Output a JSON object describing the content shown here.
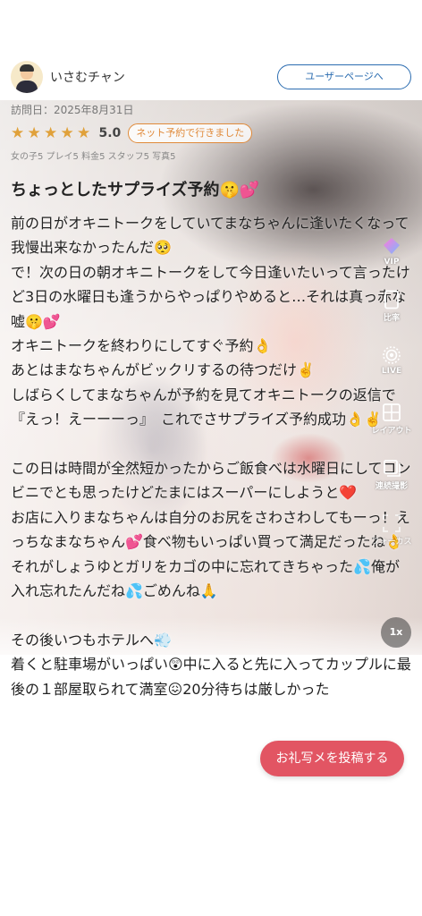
{
  "header": {
    "username": "いさむチャン",
    "user_page_button": "ユーザーページへ"
  },
  "visit": {
    "date_text": "訪問日：2025年8月31日"
  },
  "rating": {
    "stars": 5,
    "score": "5.0",
    "badge": "ネット予約で行きました",
    "sub_ratings": "女の子5 プレイ5 料金5 スタッフ5 写真5"
  },
  "review": {
    "title": "ちょっとしたサプライズ予約🤫💕",
    "body": "前の日がオキニトークをしていてまなちゃんに逢いたくなって我慢出来なかったんだ🥺\nで！次の日の朝オキニトークをして今日逢いたいって言ったけど3日の水曜日も逢うからやっぱりやめると…それは真っ赤な嘘🤫💕\nオキニトークを終わりにしてすぐ予約👌\nあとはまなちゃんがビックリするの待つだけ✌️\nしばらくしてまなちゃんが予約を見てオキニトークの返信で『えっ！えーーーっ』　これでさサプライズ予約成功👌✌️\n\nこの日は時間が全然短かったからご飯食べは水曜日にしてコンビニでとも思ったけどたまにはスーパーにしようと❤️\nお店に入りまなちゃんは自分のお尻をさわさわしてもーっ！えっちなまなちゃん💕食べ物もいっぱい買って満足だったね👌\nそれがしょうゆとガリをカゴの中に忘れてきちゃった💦俺が入れ忘れたんだね💦ごめんね🙏\n\nその後いつもホテルへ💨\n着くと駐車場がいっぱい😲中に入ると先に入ってカップルに最後の１部屋取られて満室😖20分待ちは厳しかった"
  },
  "side_tools": {
    "vip": "VIP",
    "ratio_icon": "3:4",
    "ratio": "比率",
    "live": "LIVE",
    "layout": "レイアウト",
    "burst": "連続撮影",
    "focus": "フォーカス"
  },
  "speed": "1x",
  "post_button": "お礼写メを投稿する",
  "colors": {
    "accent_blue": "#2b6cb0",
    "star": "#e0a13a",
    "badge_orange": "#e08a3a",
    "post_button": "#e25563"
  }
}
